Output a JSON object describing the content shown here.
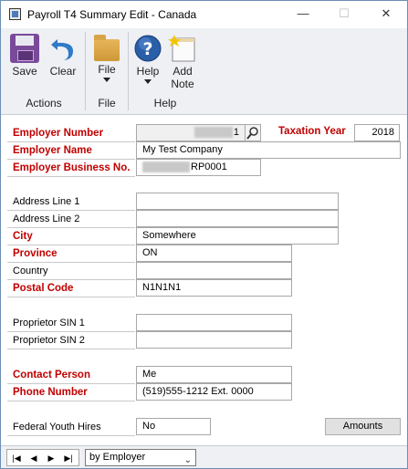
{
  "window": {
    "title": "Payroll T4 Summary Edit  -  Canada",
    "controls": {
      "minimize": "—",
      "maximize": "☐",
      "close": "✕"
    }
  },
  "ribbon": {
    "buttons": {
      "save": "Save",
      "clear": "Clear",
      "file": "File",
      "help": "Help",
      "add_note_line1": "Add",
      "add_note_line2": "Note"
    },
    "groups": {
      "actions": "Actions",
      "file": "File",
      "help": "Help"
    }
  },
  "form": {
    "employer_number": {
      "label": "Employer Number",
      "value": "1"
    },
    "taxation_year": {
      "label": "Taxation Year",
      "value": "2018"
    },
    "employer_name": {
      "label": "Employer Name",
      "value": "My Test Company"
    },
    "employer_business_no": {
      "label": "Employer Business No.",
      "value": "RP0001"
    },
    "address_line_1": {
      "label": "Address Line 1",
      "value": ""
    },
    "address_line_2": {
      "label": "Address Line 2",
      "value": ""
    },
    "city": {
      "label": "City",
      "value": "Somewhere"
    },
    "province": {
      "label": "Province",
      "value": "ON"
    },
    "country": {
      "label": "Country",
      "value": ""
    },
    "postal_code": {
      "label": "Postal Code",
      "value": "N1N1N1"
    },
    "proprietor_sin_1": {
      "label": "Proprietor SIN 1",
      "value": ""
    },
    "proprietor_sin_2": {
      "label": "Proprietor SIN 2",
      "value": ""
    },
    "contact_person": {
      "label": "Contact Person",
      "value": "Me"
    },
    "phone_number": {
      "label": "Phone Number",
      "value": "(519)555-1212 Ext. 0000"
    },
    "federal_youth_hires": {
      "label": "Federal Youth Hires",
      "value": "No"
    },
    "amounts_button": "Amounts"
  },
  "bottombar": {
    "sort_select": "by Employer",
    "nav": {
      "first": "|◀",
      "prev": "◀",
      "next": "▶",
      "last": "▶|"
    }
  },
  "colors": {
    "required_label": "#c00000",
    "ribbon_bg": "#eef0f4"
  }
}
